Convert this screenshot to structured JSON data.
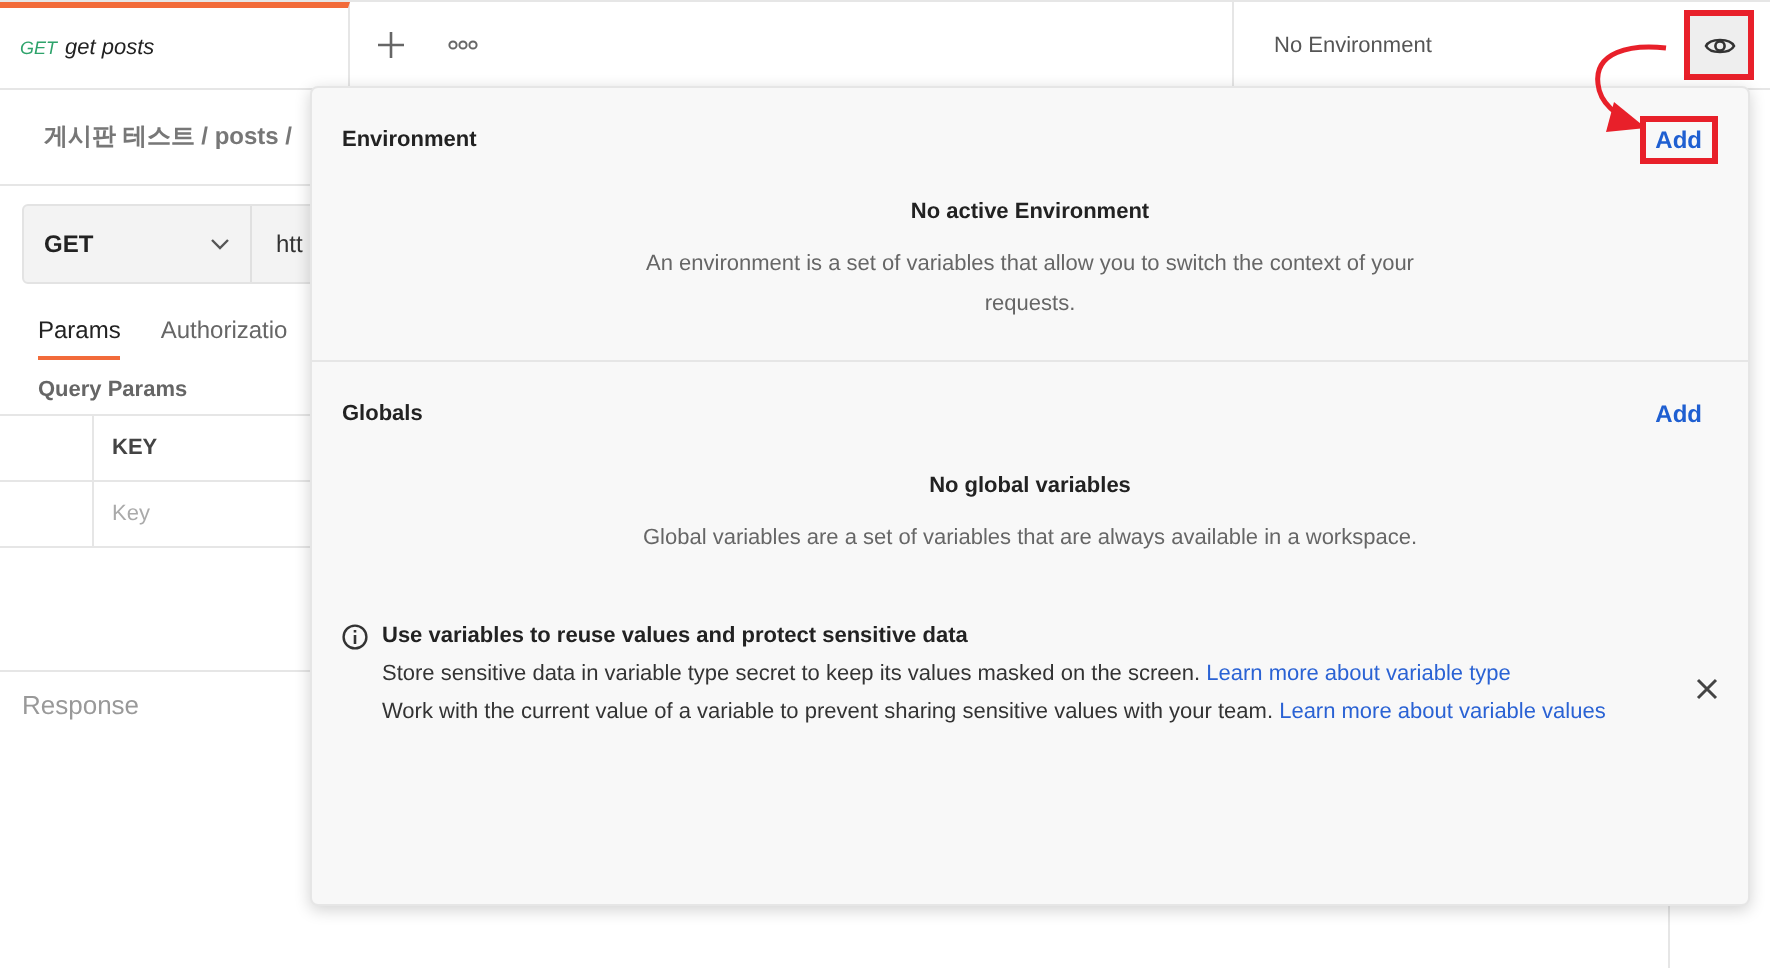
{
  "tabs": [
    {
      "method": "GET",
      "title": "get posts",
      "selected": true
    }
  ],
  "environment_selector": {
    "value": "No Environment"
  },
  "eye_button": {
    "highlighted": true
  },
  "breadcrumb": "게시판 테스트 / posts /",
  "request": {
    "method": "GET",
    "url": "htt"
  },
  "request_tabs": [
    {
      "label": "Params",
      "selected": true
    },
    {
      "label": "Authorizatio",
      "selected": false
    }
  ],
  "query_params": {
    "title": "Query Params",
    "columns": [
      "KEY"
    ],
    "placeholder": "Key"
  },
  "response": {
    "title": "Response"
  },
  "popover": {
    "sections": [
      {
        "title": "Environment",
        "add": "Add",
        "highlighted": true,
        "empty_title": "No active Environment",
        "empty_text": "An environment is a set of variables that allow you to switch the context of your requests."
      },
      {
        "title": "Globals",
        "add": "Add",
        "highlighted": false,
        "empty_title": "No global variables",
        "empty_text": "Global variables are a set of variables that are always available in a workspace."
      }
    ],
    "tip": {
      "title": "Use variables to reuse values and protect sensitive data",
      "lines": [
        {
          "text": "Store sensitive data in variable type secret to keep its values masked on the screen.",
          "link": "Learn more about variable type"
        },
        {
          "text": "Work with the current value of a variable to prevent sharing sensitive values with your team.",
          "link": "Learn more about variable values"
        }
      ]
    }
  }
}
